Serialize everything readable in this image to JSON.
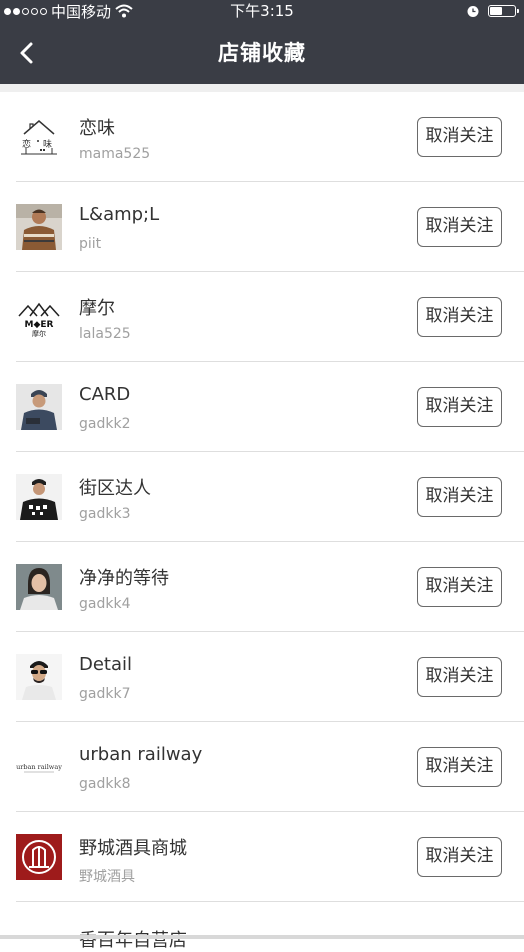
{
  "status_bar": {
    "carrier": "中国移动",
    "time": "下午3:15",
    "signal_dots_filled": 2,
    "signal_dots_total": 5,
    "icons": [
      "wifi-icon",
      "alarm-icon",
      "battery-icon"
    ],
    "battery_level": 0.5
  },
  "nav": {
    "title": "店铺收藏",
    "back_icon": "chevron-left-icon"
  },
  "colors": {
    "header_bg": "#3a3d45",
    "divider": "#dedede",
    "sub_text": "#a0a0a0"
  },
  "stores": [
    {
      "name": "恋味",
      "handle": "mama525",
      "button": "取消关注",
      "avatar": "house-logo"
    },
    {
      "name": "L&amp;L",
      "handle": "piit",
      "button": "取消关注",
      "avatar": "person-sweater"
    },
    {
      "name": "摩尔",
      "handle": "lala525",
      "button": "取消关注",
      "avatar": "moer-logo",
      "avatar_text": "M◆ER 摩尔"
    },
    {
      "name": "CARD",
      "handle": "gadkk2",
      "button": "取消关注",
      "avatar": "person-cap"
    },
    {
      "name": "街区达人",
      "handle": "gadkk3",
      "button": "取消关注",
      "avatar": "person-tee"
    },
    {
      "name": "净净的等待",
      "handle": "gadkk4",
      "button": "取消关注",
      "avatar": "person-portrait"
    },
    {
      "name": "Detail",
      "handle": "gadkk7",
      "button": "取消关注",
      "avatar": "person-sunglasses"
    },
    {
      "name": "urban railway",
      "handle": "gadkk8",
      "button": "取消关注",
      "avatar": "urban-logo",
      "avatar_text": "urban railway"
    },
    {
      "name": "野城酒具商城",
      "handle": "野城酒具",
      "button": "取消关注",
      "avatar": "red-logo"
    },
    {
      "name": "香百年自营店",
      "handle": "",
      "button": "",
      "avatar": "partial"
    }
  ]
}
